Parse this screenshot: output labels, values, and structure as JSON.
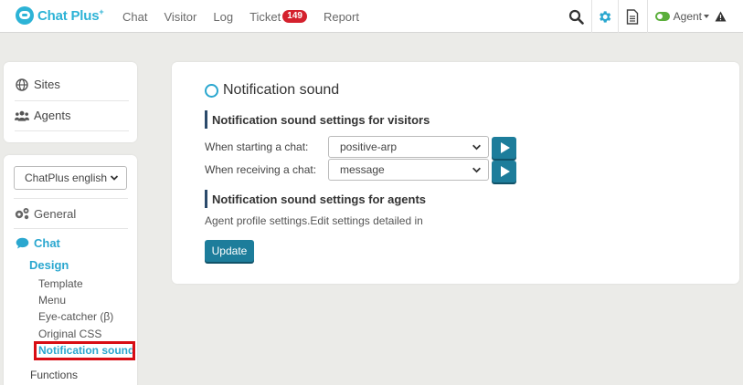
{
  "header": {
    "logo_text": "Chat Plus",
    "logo_sup": "+",
    "nav": [
      {
        "label": "Chat"
      },
      {
        "label": "Visitor"
      },
      {
        "label": "Log"
      },
      {
        "label": "Ticket",
        "badge": "149"
      },
      {
        "label": "Report"
      }
    ],
    "agent_label": "Agent",
    "icons": [
      "search-icon",
      "gear-icon",
      "document-icon",
      "status-toggle-icon",
      "warning-icon"
    ]
  },
  "sidebar": {
    "top_items": [
      {
        "label": "Sites",
        "icon": "globe-icon"
      },
      {
        "label": "Agents",
        "icon": "users-icon"
      }
    ],
    "site_select_value": "ChatPlus english",
    "general_label": "General",
    "chat_label": "Chat",
    "design_label": "Design",
    "design_items": [
      {
        "label": "Template"
      },
      {
        "label": "Menu"
      },
      {
        "label": "Eye-catcher (β)"
      },
      {
        "label": "Original CSS"
      },
      {
        "label": "Notification sound"
      }
    ],
    "active_item": "Notification sound",
    "functions_label": "Functions"
  },
  "main": {
    "title": "Notification sound",
    "visitors_heading": "Notification sound settings for visitors",
    "start_label": "When starting a chat:",
    "start_value": "positive-arp",
    "receive_label": "When receiving a chat:",
    "receive_value": "message",
    "agents_heading": "Notification sound settings for agents",
    "agents_text": "Agent profile settings.Edit settings detailed in",
    "update_label": "Update"
  },
  "colors": {
    "accent": "#2aa7cf",
    "button": "#1d7d9b",
    "badge": "#d4212d",
    "highlight_border": "#d80d14",
    "background": "#ebebe8"
  }
}
